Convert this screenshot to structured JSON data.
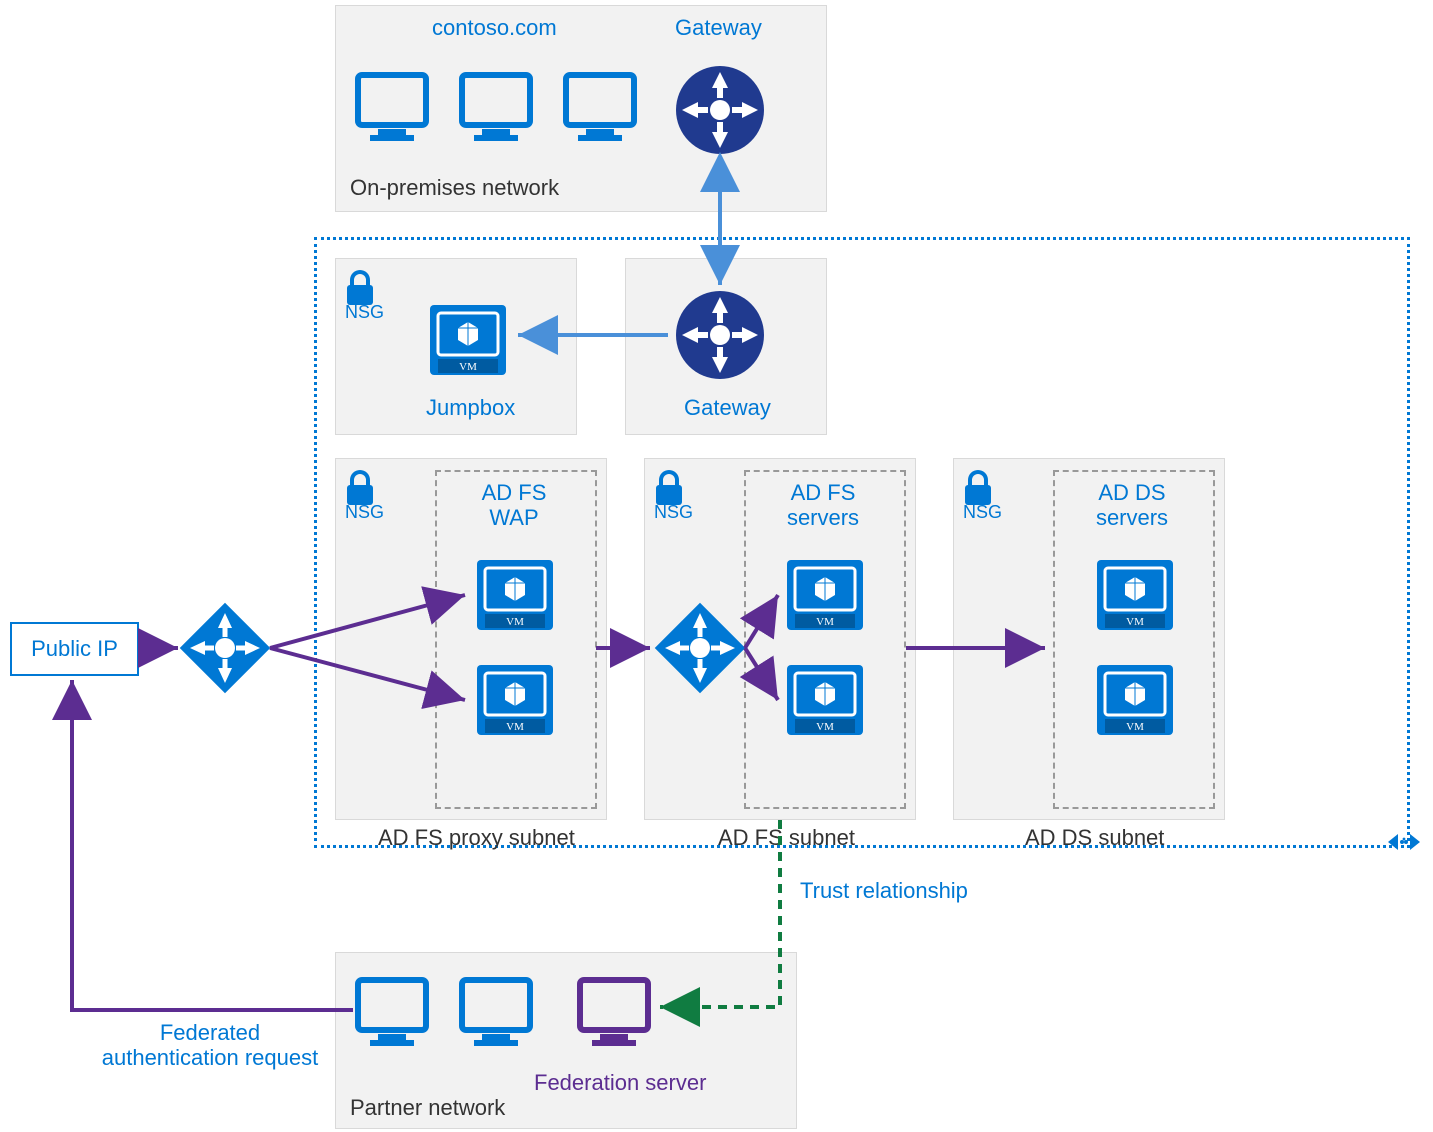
{
  "onprem": {
    "title": "On-premises network",
    "domain": "contoso.com",
    "gateway_label": "Gateway"
  },
  "jumpbox": {
    "nsg": "NSG",
    "label": "Jumpbox",
    "gateway_label": "Gateway"
  },
  "wap": {
    "nsg": "NSG",
    "title": "AD FS\nWAP",
    "subnet": "AD FS proxy subnet"
  },
  "adfs": {
    "nsg": "NSG",
    "title": "AD FS\nservers",
    "subnet": "AD FS subnet"
  },
  "adds": {
    "nsg": "NSG",
    "title": "AD DS\nservers",
    "subnet": "AD DS subnet"
  },
  "public_ip": "Public IP",
  "trust": "Trust relationship",
  "federated": "Federated\nauthentication request",
  "partner": {
    "label": "Partner network",
    "federation_server": "Federation server"
  },
  "colors": {
    "azure_blue": "#0078d4",
    "azure_dark": "#203a8f",
    "purple": "#5c2d91",
    "teal": "#107c41",
    "steel": "#4a90d9"
  }
}
